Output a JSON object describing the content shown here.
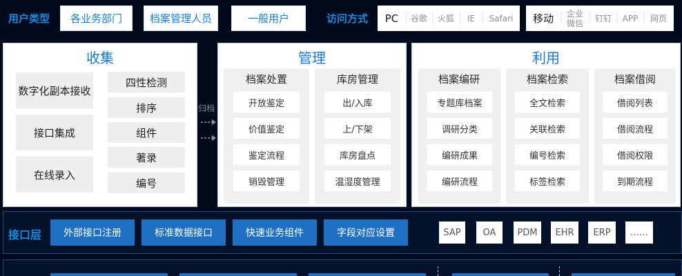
{
  "user_types": {
    "label": "用户类型",
    "items": [
      "各业务部门",
      "档案管理人员",
      "一般用户"
    ]
  },
  "access": {
    "label": "访问方式",
    "pc": {
      "main": "PC",
      "subs": [
        "谷歌",
        "火狐",
        "IE",
        "Safari"
      ]
    },
    "mobile": {
      "main": "移动",
      "subs": [
        "企业\n微信",
        "钉钉",
        "APP",
        "网页"
      ]
    }
  },
  "collect": {
    "title": "收集",
    "left_items": [
      "数字化副本接收",
      "接口集成",
      "在线录入"
    ],
    "right_items": [
      "四性检测",
      "排序",
      "组件",
      "著录",
      "编号"
    ]
  },
  "arrow_label": "归档",
  "manage": {
    "title": "管理",
    "columns": [
      {
        "header": "档案处置",
        "items": [
          "开放鉴定",
          "价值鉴定",
          "鉴定流程",
          "销毁管理"
        ]
      },
      {
        "header": "库房管理",
        "items": [
          "出/入库",
          "上/下架",
          "库房盘点",
          "温湿度管理"
        ]
      }
    ]
  },
  "use": {
    "title": "利用",
    "columns": [
      {
        "header": "档案编研",
        "items": [
          "专题库档案",
          "调研分类",
          "编研成果",
          "编研流程"
        ]
      },
      {
        "header": "档案检索",
        "items": [
          "全文检索",
          "关联检索",
          "编号检索",
          "标签检索"
        ]
      },
      {
        "header": "档案借阅",
        "items": [
          "借阅列表",
          "借阅流程",
          "借阅权限",
          "到期流程"
        ]
      }
    ]
  },
  "interface_layer": {
    "title": "接口层",
    "buttons": [
      "外部接口注册",
      "标准数据接口",
      "快速业务组件",
      "字段对应设置"
    ],
    "systems": [
      "SAP",
      "OA",
      "PDM",
      "EHR",
      "ERP",
      "……"
    ]
  },
  "colors": {
    "background": "#010b1d",
    "accent_blue": "#1a8be0",
    "button_blue": "#1f6fc2"
  }
}
